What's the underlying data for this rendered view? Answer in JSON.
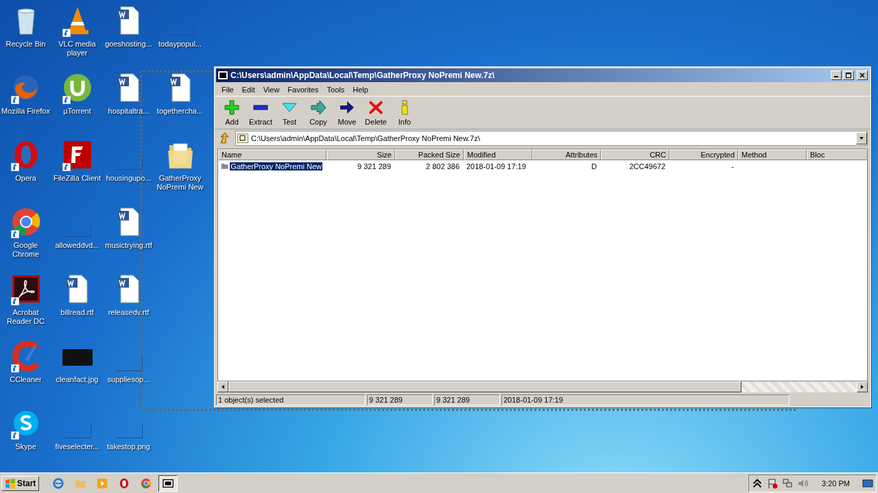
{
  "desktop": {
    "columns": [
      [
        {
          "label": "Recycle Bin",
          "kind": "recycle",
          "shortcut": false
        },
        {
          "label": "Mozilla Firefox",
          "kind": "firefox",
          "shortcut": true
        },
        {
          "label": "Opera",
          "kind": "opera",
          "shortcut": true
        },
        {
          "label": "Google Chrome",
          "kind": "chrome",
          "shortcut": true
        },
        {
          "label": "Acrobat Reader DC",
          "kind": "acrobat",
          "shortcut": true
        },
        {
          "label": "CCleaner",
          "kind": "ccleaner",
          "shortcut": true
        },
        {
          "label": "Skype",
          "kind": "skype",
          "shortcut": true
        }
      ],
      [
        {
          "label": "VLC media player",
          "kind": "vlc",
          "shortcut": true
        },
        {
          "label": "µTorrent",
          "kind": "utorrent",
          "shortcut": true
        },
        {
          "label": "FileZilla Client",
          "kind": "filezilla",
          "shortcut": true
        },
        {
          "label": "alloweddvd...",
          "kind": "blank",
          "shortcut": false
        },
        {
          "label": "billread.rtf",
          "kind": "word",
          "shortcut": false
        },
        {
          "label": "cleanfact.jpg",
          "kind": "image",
          "shortcut": false
        },
        {
          "label": "fiveselecter...",
          "kind": "blank",
          "shortcut": false
        }
      ],
      [
        {
          "label": "goeshosting...",
          "kind": "word",
          "shortcut": false
        },
        {
          "label": "hospitaltra...",
          "kind": "word",
          "shortcut": false
        },
        {
          "label": "housingupo...",
          "kind": "blank",
          "shortcut": false
        },
        {
          "label": "musictrying.rtf",
          "kind": "word",
          "shortcut": false
        },
        {
          "label": "releasedv.rtf",
          "kind": "word",
          "shortcut": false
        },
        {
          "label": "suppliesop...",
          "kind": "blank",
          "shortcut": false
        },
        {
          "label": "takestop.png",
          "kind": "blank",
          "shortcut": false
        }
      ],
      [
        {
          "label": "todaypopul...",
          "kind": "blank",
          "shortcut": false
        },
        {
          "label": "togethercha...",
          "kind": "word",
          "shortcut": false
        },
        {
          "label": "GatherProxy NoPremi New",
          "kind": "folder",
          "shortcut": false
        }
      ]
    ]
  },
  "window": {
    "title": "C:\\Users\\admin\\AppData\\Local\\Temp\\GatherProxy NoPremi New.7z\\",
    "menu": [
      "File",
      "Edit",
      "View",
      "Favorites",
      "Tools",
      "Help"
    ],
    "toolbar": [
      {
        "label": "Add",
        "kind": "add"
      },
      {
        "label": "Extract",
        "kind": "extract"
      },
      {
        "label": "Test",
        "kind": "test"
      },
      {
        "label": "Copy",
        "kind": "copy"
      },
      {
        "label": "Move",
        "kind": "move"
      },
      {
        "label": "Delete",
        "kind": "delete"
      },
      {
        "label": "Info",
        "kind": "info"
      }
    ],
    "address": "C:\\Users\\admin\\AppData\\Local\\Temp\\GatherProxy NoPremi New.7z\\",
    "columns": [
      "Name",
      "Size",
      "Packed Size",
      "Modified",
      "Attributes",
      "CRC",
      "Encrypted",
      "Method",
      "Bloc"
    ],
    "rows": [
      {
        "selected": true,
        "cells": [
          "GatherProxy NoPremi New",
          "9 321 289",
          "2 802 386",
          "2018-01-09 17:19",
          "D",
          "2CC49672",
          "-"
        ]
      }
    ],
    "status": [
      "1 object(s) selected",
      "9 321 289",
      "9 321 289",
      "2018-01-09 17:19"
    ]
  },
  "taskbar": {
    "start": "Start",
    "apps": [
      {
        "kind": "ie",
        "selected": false
      },
      {
        "kind": "explorer",
        "selected": false
      },
      {
        "kind": "media",
        "selected": false
      },
      {
        "kind": "opera",
        "selected": false
      },
      {
        "kind": "chrome",
        "selected": false
      },
      {
        "kind": "sevenzip",
        "selected": true
      }
    ],
    "clock": "3:20 PM"
  }
}
